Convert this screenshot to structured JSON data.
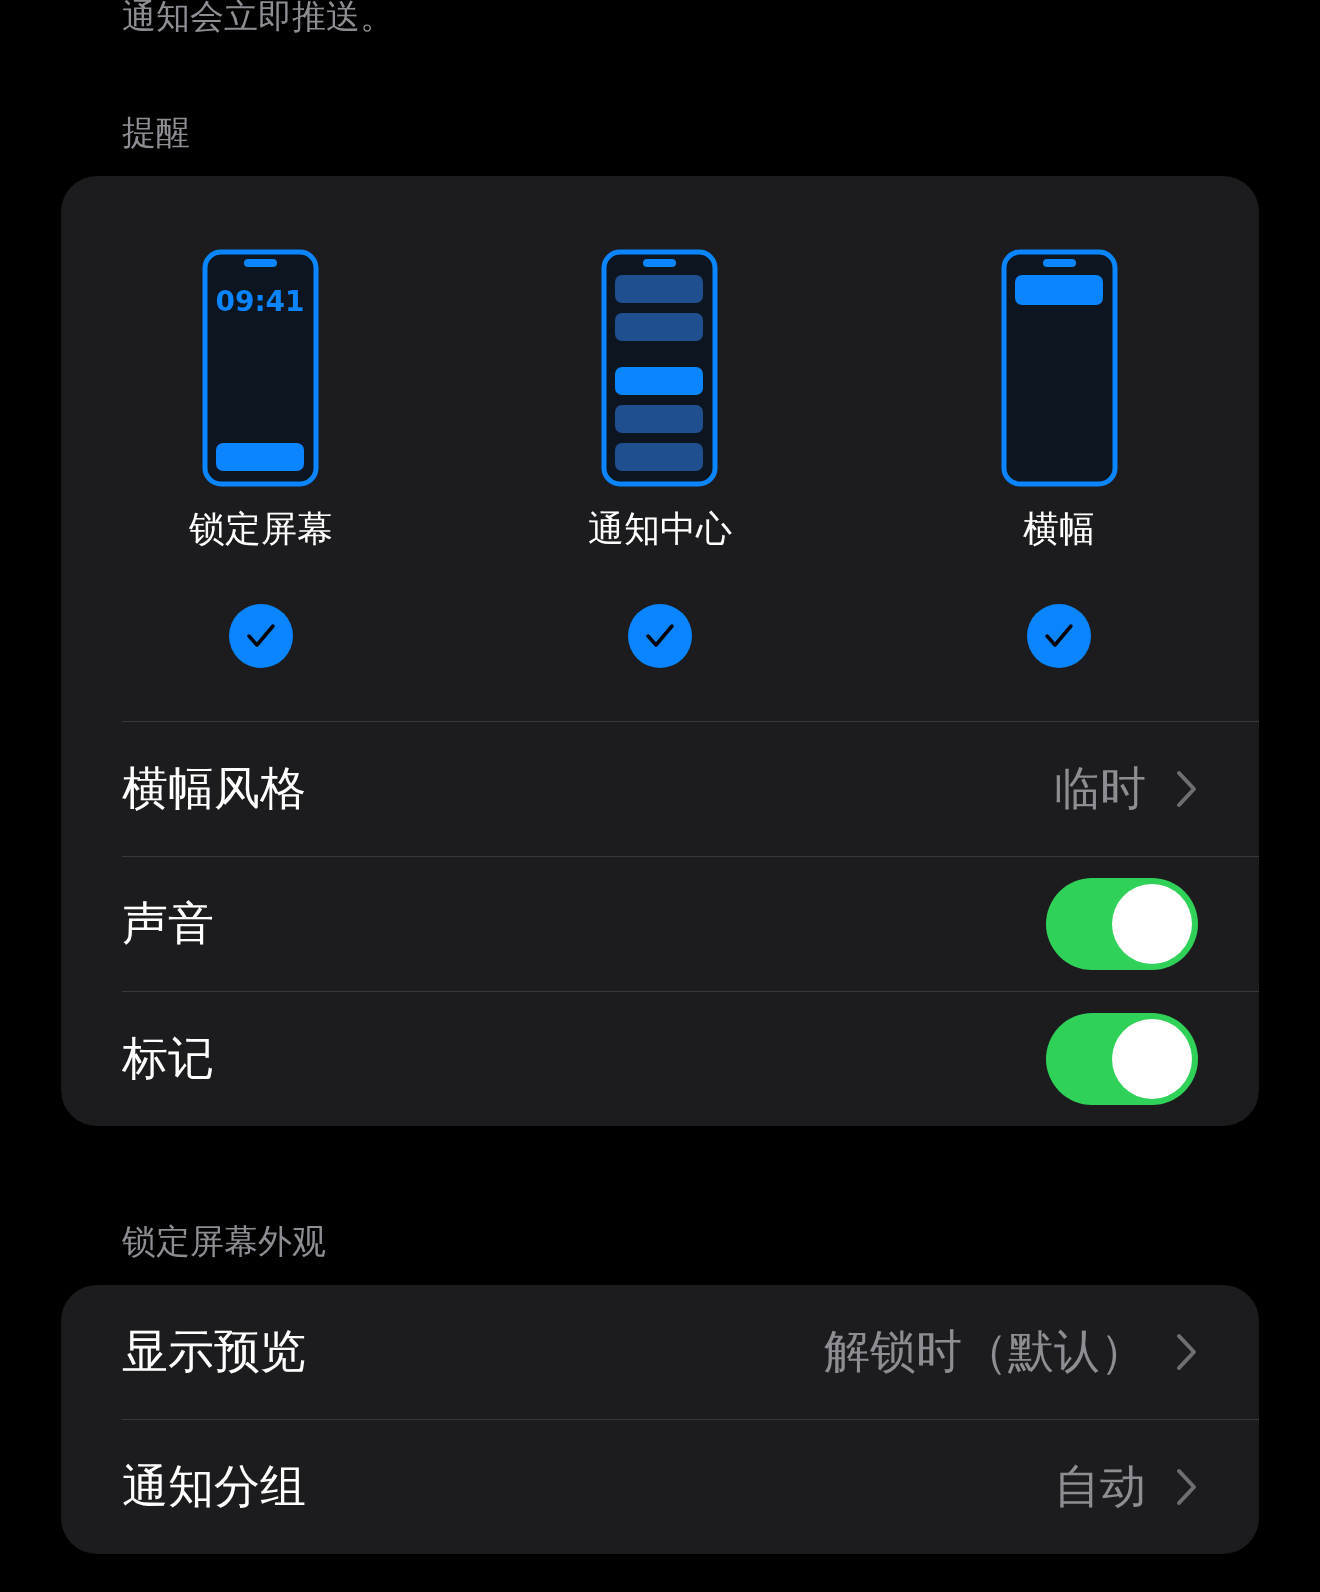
{
  "intro": "通知会立即推送。",
  "sections": [
    {
      "header": "提醒",
      "alert_styles": [
        {
          "kind": "lock",
          "label": "锁定屏幕",
          "time": "09:41",
          "checked": true
        },
        {
          "kind": "center",
          "label": "通知中心",
          "checked": true
        },
        {
          "kind": "banner",
          "label": "横幅",
          "checked": true
        }
      ],
      "rows": [
        {
          "kind": "link",
          "label": "横幅风格",
          "value": "临时"
        },
        {
          "kind": "toggle",
          "label": "声音",
          "on": true
        },
        {
          "kind": "toggle",
          "label": "标记",
          "on": true
        }
      ]
    },
    {
      "header": "锁定屏幕外观",
      "rows": [
        {
          "kind": "link",
          "label": "显示预览",
          "value": "解锁时（默认）"
        },
        {
          "kind": "link",
          "label": "通知分组",
          "value": "自动"
        }
      ]
    }
  ]
}
